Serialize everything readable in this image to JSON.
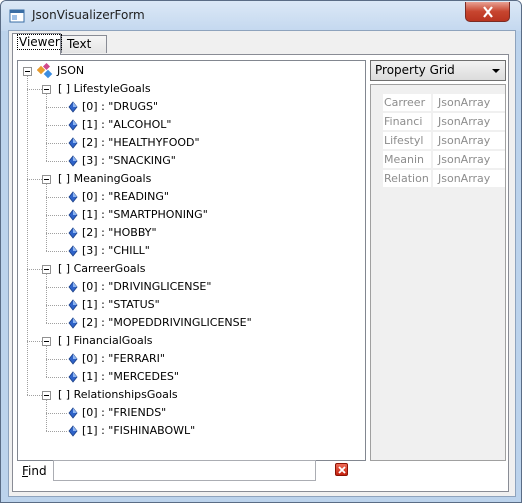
{
  "window": {
    "title": "JsonVisualizerForm"
  },
  "tabs": [
    {
      "label": "Viewer",
      "active": true
    },
    {
      "label": "Text",
      "active": false
    }
  ],
  "tree": {
    "root": "JSON",
    "groups": [
      {
        "name": "[ ]  LifestyleGoals",
        "items": [
          "[0] : \"DRUGS\"",
          "[1] : \"ALCOHOL\"",
          "[2] : \"HEALTHYFOOD\"",
          "[3] : \"SNACKING\""
        ]
      },
      {
        "name": "[ ]  MeaningGoals",
        "items": [
          "[0] : \"READING\"",
          "[1] : \"SMARTPHONING\"",
          "[2] : \"HOBBY\"",
          "[3] : \"CHILL\""
        ]
      },
      {
        "name": "[ ]  CarreerGoals",
        "items": [
          "[0] : \"DRIVINGLICENSE\"",
          "[1] : \"STATUS\"",
          "[2] : \"MOPEDDRIVINGLICENSE\""
        ]
      },
      {
        "name": "[ ]  FinancialGoals",
        "items": [
          "[0] : \"FERRARI\"",
          "[1] : \"MERCEDES\""
        ]
      },
      {
        "name": "[ ]  RelationshipsGoals",
        "items": [
          "[0] : \"FRIENDS\"",
          "[1] : \"FISHINABOWL\""
        ]
      }
    ]
  },
  "find": {
    "label": "Find",
    "value": ""
  },
  "property_grid": {
    "selector": "Property Grid",
    "rows": [
      {
        "name": "Carreer",
        "value": "JsonArray"
      },
      {
        "name": "Financi",
        "value": "JsonArray"
      },
      {
        "name": "Lifestyl",
        "value": "JsonArray"
      },
      {
        "name": "Meanin",
        "value": "JsonArray"
      },
      {
        "name": "Relation",
        "value": "JsonArray"
      }
    ]
  },
  "icons": {
    "root": "json-root-icon",
    "item": "blue-gem-icon",
    "clear": "red-x-clear-icon",
    "close": "window-close-icon"
  },
  "colors": {
    "close_button": "#c7452f",
    "item_icon": "#2f63c8",
    "selection_frame": "#bcd3ec"
  }
}
